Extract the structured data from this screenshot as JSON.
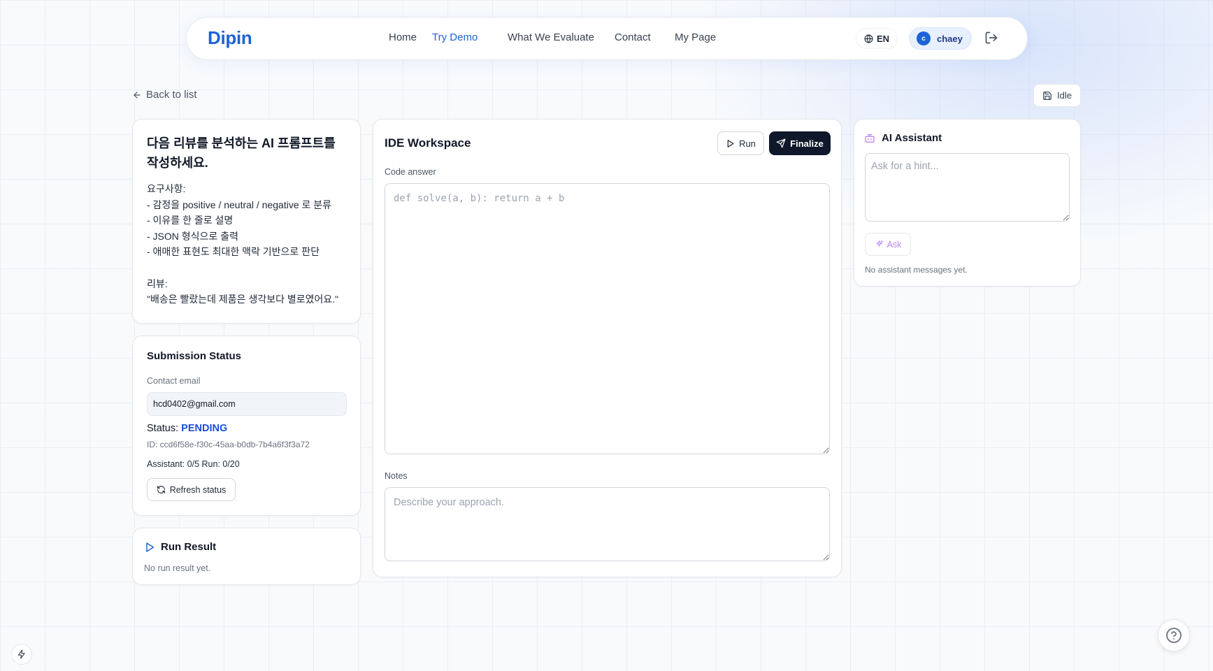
{
  "nav": {
    "logo": "Dipin",
    "links": [
      "Home",
      "Try Demo",
      "What We Evaluate",
      "Contact",
      "My Page"
    ],
    "active_link": "Try Demo",
    "lang": "EN",
    "user_initial": "c",
    "user_name": "chaey",
    "accent_color": "#1d63d6"
  },
  "back_label": "Back to list",
  "save_state": "Idle",
  "problem": {
    "title": "다음 리뷰를 분석하는 AI 프롬프트를 작성하세요.",
    "body": "요구사항:\n- 감정을 positive / neutral / negative 로 분류\n- 이유를 한 줄로 설명\n- JSON 형식으로 출력\n- 애매한 표현도 최대한 맥락 기반으로 판단\n\n리뷰:\n\"배송은 빨랐는데 제품은 생각보다 별로였어요.\""
  },
  "submission": {
    "title": "Submission Status",
    "email_label": "Contact email",
    "email_value": "hcd0402@gmail.com",
    "status_label": "Status:",
    "status_value": "PENDING",
    "id_text": "ID: ccd6f58e-f30c-45aa-b0db-7b4a6f3f3a72",
    "counts_text": "Assistant: 0/5  Run: 0/20",
    "refresh_label": "Refresh status",
    "status_color": "#1d4fd8"
  },
  "run_result": {
    "title": "Run Result",
    "empty_text": "No run result yet."
  },
  "ide": {
    "title": "IDE Workspace",
    "run_label": "Run",
    "finalize_label": "Finalize",
    "code_label": "Code answer",
    "code_placeholder": "def solve(a, b): return a + b",
    "code_value": "",
    "notes_label": "Notes",
    "notes_placeholder": "Describe your approach.",
    "notes_value": ""
  },
  "assistant": {
    "title": "AI Assistant",
    "input_placeholder": "Ask for a hint...",
    "input_value": "",
    "ask_label": "Ask",
    "empty_text": "No assistant messages yet.",
    "icon_color": "#c084fc"
  },
  "icons": {
    "globe": "globe-icon",
    "logout": "logout-icon",
    "back": "arrow-left-icon",
    "save": "save-icon",
    "refresh": "refresh-icon",
    "play": "play-icon",
    "send": "send-icon",
    "bot": "bot-icon",
    "sparkles": "sparkles-icon",
    "help": "help-circle-icon",
    "bolt": "bolt-icon"
  }
}
